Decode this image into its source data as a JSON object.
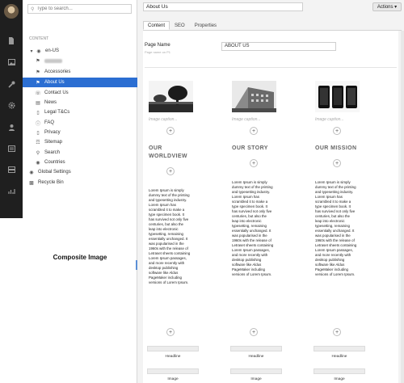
{
  "rail": {
    "icons": [
      "avatar",
      "file-icon",
      "image-icon",
      "wrench-icon",
      "gear-icon",
      "user-icon",
      "list-icon",
      "template-icon",
      "chart-icon"
    ]
  },
  "tree": {
    "search_placeholder": "Type to search...",
    "section_label": "CONTENT",
    "root_label": "en-US",
    "items": [
      {
        "label": "Accessories",
        "icon": "tag-icon"
      },
      {
        "label": "About Us",
        "icon": "tag-icon"
      },
      {
        "label": "Contact Us",
        "icon": "phone-icon"
      },
      {
        "label": "News",
        "icon": "news-icon"
      },
      {
        "label": "Legal T&Cs",
        "icon": "document-icon"
      },
      {
        "label": "FAQ",
        "icon": "question-icon"
      },
      {
        "label": "Privacy",
        "icon": "document-icon"
      },
      {
        "label": "Sitemap",
        "icon": "sitemap-icon"
      },
      {
        "label": "Search",
        "icon": "search-icon"
      },
      {
        "label": "Countries",
        "icon": "globe-icon"
      }
    ],
    "global_settings": "Global Settings",
    "recycle_bin": "Recycle Bin",
    "composite_image": "Composite Image"
  },
  "header": {
    "title": "About Us",
    "actions_label": "Actions ▾"
  },
  "tabs": [
    "Content",
    "SEO",
    "Properties"
  ],
  "page_name": {
    "label": "Page Name",
    "sublabel": "Page name on P1",
    "value": "ABOUT US"
  },
  "columns": [
    {
      "caption": "Image caption...",
      "heading_line1": "OUR",
      "heading_line2": "WORLDVIEW",
      "body": "Lorem Ipsum is simply dummy text of the printing and typesetting industry. Lorem Ipsum has scrambled it to make a type specimen book. It has survived not only five centuries, but also the leap into electronic typesetting, remaining essentially unchanged. It was popularised in the 1960s with the release of Letraset sheets containing Lorem Ipsum passages, and more recently with desktop publishing software like Aldus PageMaker including versions of Lorem Ipsum.",
      "field1_label": "Headline",
      "field2_label": "Image"
    },
    {
      "caption": "Image caption...",
      "heading_line1": "OUR STORY",
      "heading_line2": "",
      "body": "Lorem Ipsum is simply dummy text of the printing and typesetting industry. Lorem Ipsum has scrambled it to make a type specimen book. It has survived not only five centuries, but also the leap into electronic typesetting, remaining essentially unchanged. It was popularised in the 1960s with the release of Letraset sheets containing Lorem Ipsum passages, and more recently with desktop publishing software like Aldus PageMaker including versions of Lorem Ipsum.",
      "field1_label": "Headline",
      "field2_label": "Image"
    },
    {
      "caption": "Image caption...",
      "heading_line1": "OUR MISSION",
      "heading_line2": "",
      "body": "Lorem Ipsum is simply dummy text of the printing and typesetting industry. Lorem Ipsum has scrambled it to make a type specimen book. It has survived not only five centuries, but also the leap into electronic typesetting, remaining essentially unchanged. It was popularised in the 1960s with the release of Letraset sheets containing Lorem Ipsum passages, and more recently with desktop publishing software like Aldus PageMaker including versions of Lorem Ipsum.",
      "field1_label": "Headline",
      "field2_label": "Image"
    }
  ],
  "colors": {
    "selected": "#2b6ed2",
    "rail": "#1f1f1f"
  }
}
